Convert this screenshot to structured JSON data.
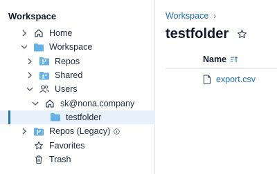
{
  "sidebar": {
    "title": "Workspace",
    "items": [
      {
        "label": "Home",
        "icon": "home-icon",
        "chevron": "right"
      },
      {
        "label": "Workspace",
        "icon": "folder-icon",
        "chevron": "down"
      },
      {
        "label": "Repos",
        "icon": "repo-folder-icon",
        "chevron": "right"
      },
      {
        "label": "Shared",
        "icon": "shared-folder-icon",
        "chevron": "right"
      },
      {
        "label": "Users",
        "icon": "users-icon",
        "chevron": "down"
      },
      {
        "label": "sk@nona.company",
        "icon": "home-icon",
        "chevron": "down"
      },
      {
        "label": "testfolder",
        "icon": "folder-icon",
        "chevron": "none",
        "selected": true
      },
      {
        "label": "Repos (Legacy)",
        "icon": "repo-folder-icon",
        "chevron": "right",
        "info": "info-icon"
      },
      {
        "label": "Favorites",
        "icon": "star-icon",
        "chevron": "none"
      },
      {
        "label": "Trash",
        "icon": "trash-icon",
        "chevron": "none"
      }
    ]
  },
  "main": {
    "breadcrumb": {
      "link": "Workspace",
      "separator": "›"
    },
    "title": "testfolder",
    "table": {
      "column_name": "Name",
      "rows": [
        {
          "name": "export.csv",
          "icon": "file-icon"
        }
      ]
    }
  },
  "colors": {
    "accent": "#2272b4",
    "folder": "#67b1e9",
    "selected_bg": "#e8f1fb",
    "text": "#1f2937"
  }
}
